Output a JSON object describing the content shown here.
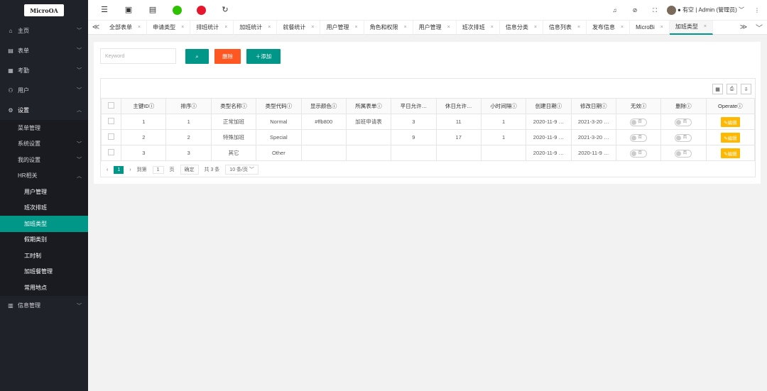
{
  "logo": "MicroOA",
  "sidebar": {
    "items": [
      {
        "icon": "⌂",
        "label": "主页",
        "arrow": "﹀"
      },
      {
        "icon": "▤",
        "label": "表单",
        "arrow": "﹀"
      },
      {
        "icon": "▦",
        "label": "考勤",
        "arrow": "﹀"
      },
      {
        "icon": "⚇",
        "label": "用户",
        "arrow": "﹀"
      },
      {
        "icon": "⚙",
        "label": "设置",
        "arrow": "︿"
      }
    ],
    "settings_sub": [
      {
        "label": "菜单管理",
        "arrow": ""
      },
      {
        "label": "系统设置",
        "arrow": "﹀"
      },
      {
        "label": "我的设置",
        "arrow": "﹀"
      },
      {
        "label": "HR相关",
        "arrow": "︿"
      }
    ],
    "hr_sub": [
      "用户管理",
      "班次排班",
      "加班类型",
      "假期类别",
      "工时制",
      "加班餐管理",
      "常用地点"
    ],
    "info": {
      "icon": "▥",
      "label": "信息管理",
      "arrow": "﹀"
    }
  },
  "topbar": {
    "user": "● 有空 | Admin (管理员) ﹀",
    "icons": [
      "☰",
      "▣",
      "▤",
      "●",
      "◉",
      "↻"
    ],
    "right_icons": [
      "♫",
      "⊘",
      "⛶"
    ],
    "more": "⋮"
  },
  "tabs": [
    "全部表单",
    "申请类型",
    "排班统计",
    "加班统计",
    "就餐统计",
    "用户管理",
    "角色和权限",
    "用户管理",
    "班次排班",
    "信息分类",
    "信息列表",
    "发布信息",
    "MicroBi",
    "加班类型"
  ],
  "tab_nav": {
    "prev": "≪",
    "next": "≫",
    "down": "﹀"
  },
  "toolbar": {
    "search_placeholder": "Keyword",
    "search_icon": "⌕",
    "delete_label": "删除",
    "add_label": "＋添加"
  },
  "table_tools": [
    "▦",
    "⎙",
    "⇩"
  ],
  "columns": [
    "主键IDⓘ",
    "排序ⓘ",
    "类型名称ⓘ",
    "类型代码ⓘ",
    "显示颜色ⓘ",
    "所属表单ⓘ",
    "平日允许…",
    "休日允许…",
    "小时间隔ⓘ",
    "创建日期ⓘ",
    "修改日期ⓘ",
    "无效ⓘ",
    "删除ⓘ",
    "Operateⓘ"
  ],
  "rows": [
    {
      "id": "1",
      "sort": "1",
      "name": "正常加班",
      "code": "Normal",
      "color": "#ffb800",
      "form": "加班申请表",
      "weekday": "3",
      "holiday": "11",
      "interval": "1",
      "created": "2020-11-9 …",
      "modified": "2021-3-20 …",
      "invalid": "否",
      "deleted": "否",
      "op": "✎编辑"
    },
    {
      "id": "2",
      "sort": "2",
      "name": "特殊加班",
      "code": "Special",
      "color": "",
      "form": "",
      "weekday": "9",
      "holiday": "17",
      "interval": "1",
      "created": "2020-11-9 …",
      "modified": "2021-3-20 …",
      "invalid": "否",
      "deleted": "否",
      "op": "✎编辑"
    },
    {
      "id": "3",
      "sort": "3",
      "name": "其它",
      "code": "Other",
      "color": "",
      "form": "",
      "weekday": "",
      "holiday": "",
      "interval": "",
      "created": "2020-11-9 …",
      "modified": "2020-11-9 …",
      "invalid": "否",
      "deleted": "否",
      "op": "✎编辑"
    }
  ],
  "pager": {
    "prev": "‹",
    "current": "1",
    "next": "›",
    "goto": "到第",
    "page_input": "1",
    "page_unit": "页",
    "confirm": "确定",
    "total": "共 3 条",
    "size": "10 条/页 ﹀"
  }
}
